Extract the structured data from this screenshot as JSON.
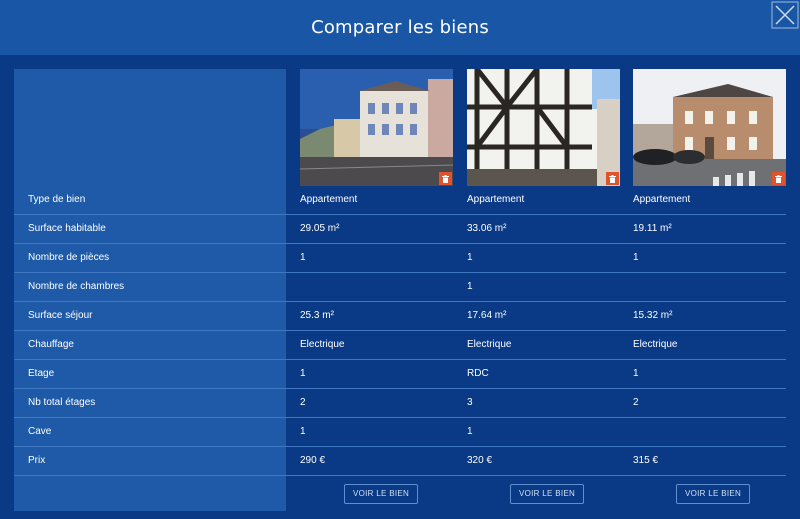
{
  "modal": {
    "title": "Comparer les biens"
  },
  "rows": [
    {
      "label": "Type de bien",
      "values": [
        "Appartement",
        "Appartement",
        "Appartement"
      ]
    },
    {
      "label": "Surface habitable",
      "values": [
        "29.05 m²",
        "33.06 m²",
        "19.11 m²"
      ]
    },
    {
      "label": "Nombre de pièces",
      "values": [
        "1",
        "1",
        "1"
      ]
    },
    {
      "label": "Nombre de chambres",
      "values": [
        "",
        "1",
        ""
      ]
    },
    {
      "label": "Surface séjour",
      "values": [
        "25.3 m²",
        "17.64 m²",
        "15.32 m²"
      ]
    },
    {
      "label": "Chauffage",
      "values": [
        "Electrique",
        "Electrique",
        "Electrique"
      ]
    },
    {
      "label": "Etage",
      "values": [
        "1",
        "RDC",
        "1"
      ]
    },
    {
      "label": "Nb total étages",
      "values": [
        "2",
        "3",
        "2"
      ]
    },
    {
      "label": "Cave",
      "values": [
        "1",
        "1",
        ""
      ]
    },
    {
      "label": "Prix",
      "values": [
        "290 €",
        "320 €",
        "315 €"
      ]
    }
  ],
  "properties": [
    {
      "view_label": "VOIR LE BIEN",
      "delete_icon": "trash-icon"
    },
    {
      "view_label": "VOIR LE BIEN",
      "delete_icon": "trash-icon"
    },
    {
      "view_label": "VOIR LE BIEN",
      "delete_icon": "trash-icon"
    }
  ],
  "colors": {
    "background": "#0a3a86",
    "header": "#1a56a6",
    "label_column": "#1e5aa8",
    "delete_button": "#e2532b"
  }
}
